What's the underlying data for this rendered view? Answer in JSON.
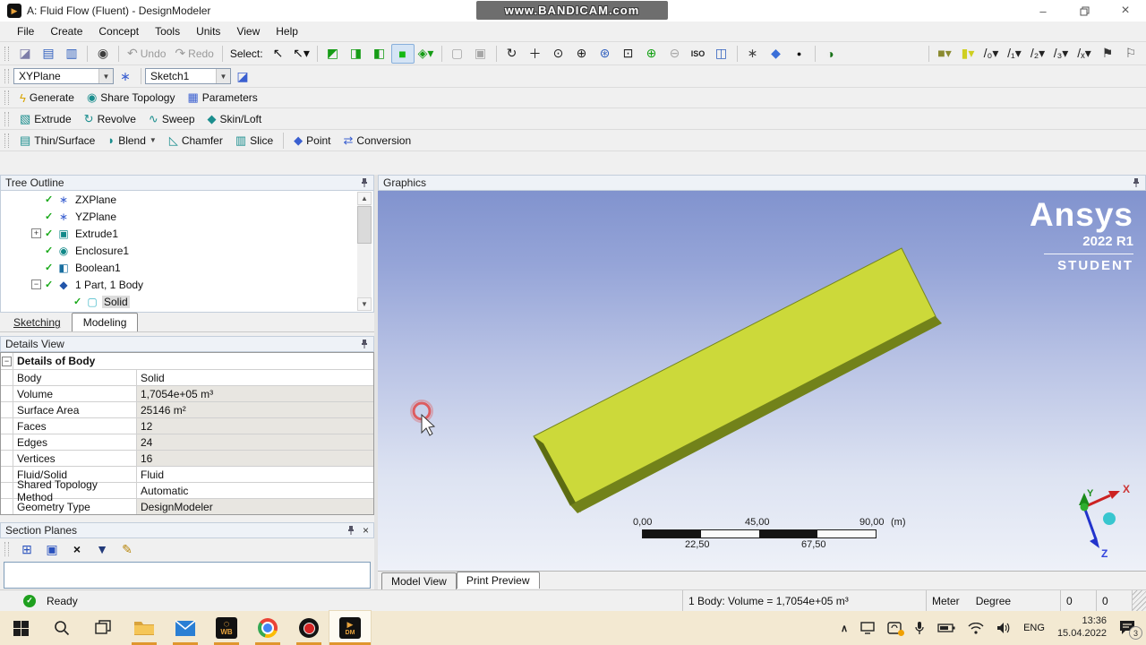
{
  "window": {
    "title": "A: Fluid Flow (Fluent) - DesignModeler",
    "watermark": "www.BANDICAM.com"
  },
  "menu": {
    "items": [
      "File",
      "Create",
      "Concept",
      "Tools",
      "Units",
      "View",
      "Help"
    ]
  },
  "toolbar_main": {
    "icons": [
      {
        "t": "grip"
      },
      {
        "t": "i",
        "name": "file-icon",
        "glyph": "◪",
        "color": "#7d7da8"
      },
      {
        "t": "i",
        "name": "save-project-icon",
        "glyph": "▤",
        "color": "#2f5fbe"
      },
      {
        "t": "i",
        "name": "save-as-icon",
        "glyph": "▥",
        "color": "#2f5fbe"
      },
      {
        "t": "s"
      },
      {
        "t": "i",
        "name": "image-capture-icon",
        "glyph": "◉",
        "color": "#3d3d3d"
      },
      {
        "t": "s"
      },
      {
        "t": "b",
        "name": "undo-button",
        "glyph": "↶",
        "label": "Undo",
        "disabled": true
      },
      {
        "t": "b",
        "name": "redo-button",
        "glyph": "↷",
        "label": "Redo",
        "disabled": true
      },
      {
        "t": "s"
      },
      {
        "t": "l",
        "name": "select-label",
        "label": "Select:"
      },
      {
        "t": "i",
        "name": "select-mode-icon",
        "glyph": "↖",
        "color": "#111111"
      },
      {
        "t": "i",
        "name": "select-mode-dropdown-icon",
        "glyph": "↖▾",
        "color": "#111111"
      },
      {
        "t": "s"
      },
      {
        "t": "i",
        "name": "vertex-filter-icon",
        "glyph": "◩",
        "color": "#169c16"
      },
      {
        "t": "i",
        "name": "edge-filter-icon",
        "glyph": "◨",
        "color": "#169c16"
      },
      {
        "t": "i",
        "name": "face-filter-icon",
        "glyph": "◧",
        "color": "#169c16"
      },
      {
        "t": "i",
        "name": "body-filter-icon",
        "glyph": "■",
        "color": "#12b812",
        "pressed": true
      },
      {
        "t": "i",
        "name": "adjacency-filter-icon",
        "glyph": "◈▾",
        "color": "#169c16"
      },
      {
        "t": "s"
      },
      {
        "t": "i",
        "name": "extend-selection-icon",
        "glyph": "▢",
        "color": "#9a9a9a",
        "disabled": true
      },
      {
        "t": "i",
        "name": "extend-selection-limits-icon",
        "glyph": "▣",
        "color": "#9a9a9a",
        "disabled": true
      },
      {
        "t": "s"
      },
      {
        "t": "i",
        "name": "rotate-icon",
        "glyph": "↻",
        "color": "#222222"
      },
      {
        "t": "i",
        "name": "pan-icon",
        "glyph": "＋",
        "color": "#222222"
      },
      {
        "t": "i",
        "name": "zoom-icon",
        "glyph": "⊙",
        "color": "#222222"
      },
      {
        "t": "i",
        "name": "zoom-in-icon",
        "glyph": "⊕",
        "color": "#222222"
      },
      {
        "t": "i",
        "name": "zoom-magnifier-icon",
        "glyph": "⊛",
        "color": "#2f5fbe"
      },
      {
        "t": "i",
        "name": "zoom-box-icon",
        "glyph": "⊡",
        "color": "#222222"
      },
      {
        "t": "i",
        "name": "zoom-fit-icon",
        "glyph": "⊕",
        "color": "#12a012"
      },
      {
        "t": "i",
        "name": "zoom-previous-icon",
        "glyph": "⊖",
        "color": "#9a9a9a",
        "disabled": true
      },
      {
        "t": "i",
        "name": "iso-view-icon",
        "glyph": "ISO",
        "color": "#222222",
        "small": true
      },
      {
        "t": "i",
        "name": "view-adjust-icon",
        "glyph": "◫",
        "color": "#2f5fbe"
      },
      {
        "t": "s"
      },
      {
        "t": "i",
        "name": "plane-display-icon",
        "glyph": "∗",
        "color": "#444444"
      },
      {
        "t": "i",
        "name": "model-appearance-icon",
        "glyph": "◆",
        "color": "#3a6fd8"
      },
      {
        "t": "i",
        "name": "point-display-icon",
        "glyph": "●",
        "color": "#111111",
        "small": true
      },
      {
        "t": "s"
      },
      {
        "t": "i",
        "name": "look-at-face-icon",
        "glyph": "◑",
        "color": "#167016"
      },
      {
        "t": "gap"
      },
      {
        "t": "s"
      },
      {
        "t": "i",
        "name": "face-color-swatch-icon",
        "glyph": "■▾",
        "color": "#8a8a30"
      },
      {
        "t": "i",
        "name": "edge-color-swatch-icon",
        "glyph": "▮▾",
        "color": "#cfcf20"
      },
      {
        "t": "i",
        "name": "edge-direction-0-icon",
        "glyph": "/₀▾",
        "color": "#222222"
      },
      {
        "t": "i",
        "name": "edge-direction-1-icon",
        "glyph": "/₁▾",
        "color": "#222222"
      },
      {
        "t": "i",
        "name": "edge-direction-2-icon",
        "glyph": "/₂▾",
        "color": "#222222"
      },
      {
        "t": "i",
        "name": "edge-direction-3-icon",
        "glyph": "/₃▾",
        "color": "#222222"
      },
      {
        "t": "i",
        "name": "edge-direction-x-icon",
        "glyph": "/ₓ▾",
        "color": "#222222"
      },
      {
        "t": "i",
        "name": "vertex-display-icon",
        "glyph": "⚑",
        "color": "#333333"
      },
      {
        "t": "i",
        "name": "frozen-body-icon",
        "glyph": "⚐",
        "color": "#555555"
      }
    ]
  },
  "toolbar_plane": {
    "plane_value": "XYPlane",
    "sketch_value": "Sketch1"
  },
  "toolbar_generate": {
    "generate_label": "Generate",
    "share_topology_label": "Share Topology",
    "parameters_label": "Parameters"
  },
  "toolbar_features": {
    "extrude_label": "Extrude",
    "revolve_label": "Revolve",
    "sweep_label": "Sweep",
    "skinloft_label": "Skin/Loft"
  },
  "toolbar_modify": {
    "thin_surface_label": "Thin/Surface",
    "blend_label": "Blend",
    "chamfer_label": "Chamfer",
    "slice_label": "Slice",
    "point_label": "Point",
    "conversion_label": "Conversion"
  },
  "tree": {
    "title": "Tree Outline",
    "items": [
      {
        "label": "ZXPlane",
        "icon": "plane-icon"
      },
      {
        "label": "YZPlane",
        "icon": "plane-icon"
      },
      {
        "label": "Extrude1",
        "icon": "extrude-icon",
        "expander": "+"
      },
      {
        "label": "Enclosure1",
        "icon": "enclosure-icon"
      },
      {
        "label": "Boolean1",
        "icon": "boolean-icon"
      },
      {
        "label": "1 Part, 1 Body",
        "icon": "part-icon",
        "expander": "-"
      },
      {
        "label": "Solid",
        "icon": "solid-body-icon",
        "selected": true
      }
    ]
  },
  "mode_tabs": {
    "sketching": "Sketching",
    "modeling": "Modeling"
  },
  "details": {
    "title": "Details View",
    "group_header": "Details of Body",
    "rows": [
      {
        "label": "Body",
        "value": "Solid",
        "readonly": false
      },
      {
        "label": "Volume",
        "value": "1,7054e+05 m³",
        "readonly": true
      },
      {
        "label": "Surface Area",
        "value": "25146 m²",
        "readonly": true
      },
      {
        "label": "Faces",
        "value": "12",
        "readonly": true
      },
      {
        "label": "Edges",
        "value": "24",
        "readonly": true
      },
      {
        "label": "Vertices",
        "value": "16",
        "readonly": true
      },
      {
        "label": "Fluid/Solid",
        "value": "Fluid",
        "readonly": false
      },
      {
        "label": "Shared Topology Method",
        "value": "Automatic",
        "readonly": false
      },
      {
        "label": "Geometry Type",
        "value": "DesignModeler",
        "readonly": true
      }
    ]
  },
  "section_planes": {
    "title": "Section Planes"
  },
  "graphics": {
    "title": "Graphics",
    "logo": {
      "brand": "Ansys",
      "version": "2022 R1",
      "edition": "STUDENT"
    },
    "ruler": {
      "t0": "0,00",
      "t1": "45,00",
      "t2": "90,00",
      "unit": "(m)",
      "b0": "22,50",
      "b1": "67,50"
    },
    "triad": {
      "x": "X",
      "y": "Y",
      "z": "Z"
    }
  },
  "view_tabs": {
    "model_view": "Model View",
    "print_preview": "Print Preview"
  },
  "status": {
    "ready": "Ready",
    "body_info": "1 Body: Volume = 1,7054e+05 m³",
    "unit_length": "Meter",
    "unit_angle": "Degree",
    "field1": "0",
    "field2": "0"
  },
  "taskbar": {
    "wb_label": "WB",
    "dm_label": "DM",
    "lang": "ENG",
    "time": "13:36",
    "date": "15.04.2022",
    "notification_count": "3"
  }
}
